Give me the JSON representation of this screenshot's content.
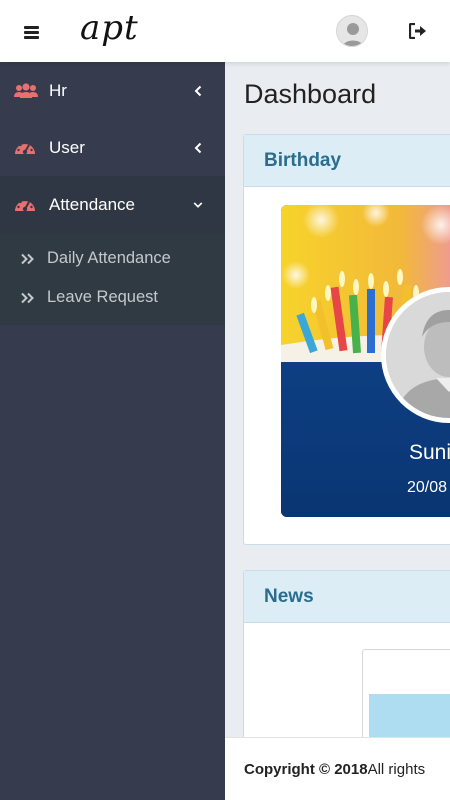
{
  "header": {
    "menu_icon": "hamburger-icon",
    "logo_text": "apt",
    "avatar_icon": "user-avatar-icon",
    "logout_icon": "logout-icon"
  },
  "sidebar": {
    "items": [
      {
        "label": "Hr",
        "icon": "users-icon",
        "chevron": "chevron-left-icon"
      },
      {
        "label": "User",
        "icon": "dashboard-gauge-icon",
        "chevron": "chevron-left-icon"
      },
      {
        "label": "Attendance",
        "icon": "dashboard-gauge-icon",
        "chevron": "chevron-down-icon",
        "expanded": true
      }
    ],
    "subitems": [
      {
        "label": "Daily Attendance",
        "icon": "double-chevron-right-icon"
      },
      {
        "label": "Leave Request",
        "icon": "double-chevron-right-icon"
      }
    ]
  },
  "main": {
    "title": "Dashboard",
    "birthday": {
      "header": "Birthday",
      "name": "Suni",
      "date": "20/08"
    },
    "news": {
      "header": "News"
    }
  },
  "footer": {
    "copyright": "Copyright © 2018",
    "rights": " All rights"
  },
  "colors": {
    "sidebar_bg": "#363c4e",
    "submenu_bg": "#2f3a43",
    "icon_accent": "#e8716f",
    "card_header_bg": "#dcedf5",
    "card_header_text": "#2a6d8f",
    "birthday_blue": "#0d3f82"
  }
}
